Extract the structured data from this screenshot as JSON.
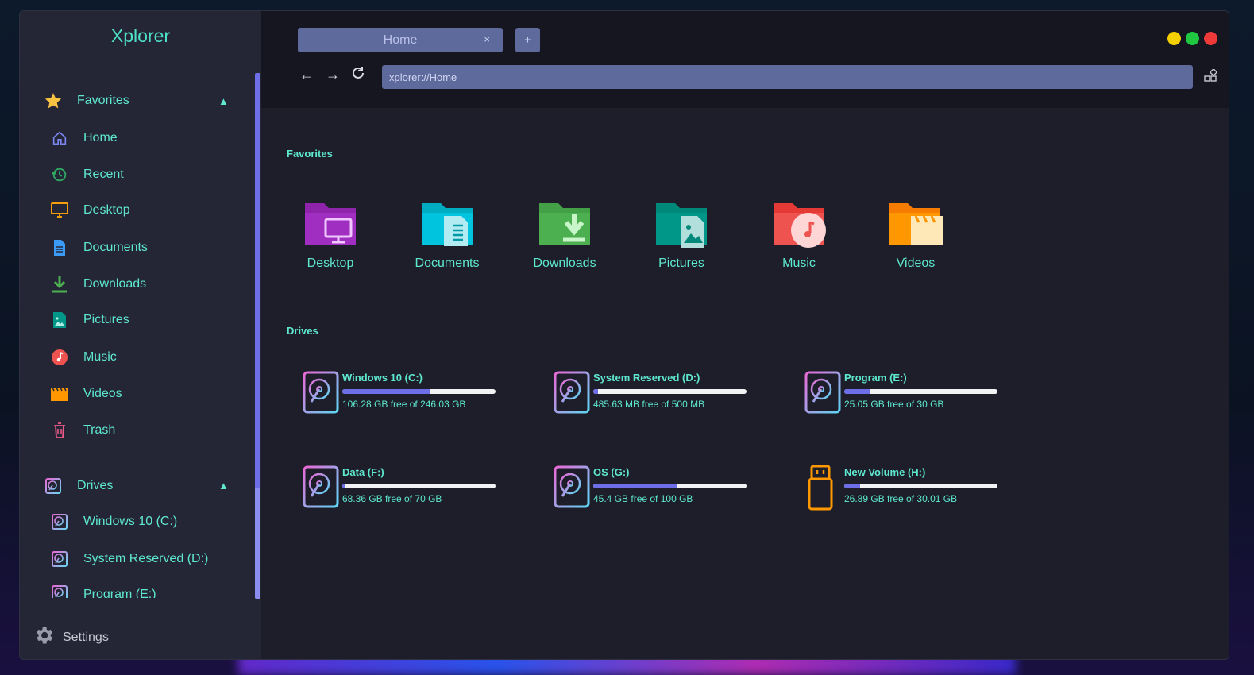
{
  "app": {
    "title": "Xplorer"
  },
  "sidebar": {
    "favorites_label": "Favorites",
    "favorites": [
      {
        "label": "Home",
        "icon": "home-icon"
      },
      {
        "label": "Recent",
        "icon": "recent-icon"
      },
      {
        "label": "Desktop",
        "icon": "desktop-icon"
      },
      {
        "label": "Documents",
        "icon": "document-icon"
      },
      {
        "label": "Downloads",
        "icon": "download-icon"
      },
      {
        "label": "Pictures",
        "icon": "picture-icon"
      },
      {
        "label": "Music",
        "icon": "music-icon"
      },
      {
        "label": "Videos",
        "icon": "video-icon"
      },
      {
        "label": "Trash",
        "icon": "trash-icon"
      }
    ],
    "drives_label": "Drives",
    "drives": [
      {
        "label": "Windows 10 (C:)"
      },
      {
        "label": "System Reserved (D:)"
      },
      {
        "label": "Program (E:)"
      }
    ],
    "settings_label": "Settings"
  },
  "tabs": [
    {
      "label": "Home",
      "close": "×"
    }
  ],
  "new_tab_label": "+",
  "nav": {
    "back": "←",
    "forward": "→",
    "reload": "⟳"
  },
  "address": {
    "value": "xplorer://Home"
  },
  "window_controls": {
    "minimize_color": "#f5d000",
    "maximize_color": "#1fc840",
    "close_color": "#f03a3a"
  },
  "main": {
    "favorites_title": "Favorites",
    "favorites": [
      {
        "label": "Desktop",
        "color": "#8e24aa"
      },
      {
        "label": "Documents",
        "color": "#00bcd4"
      },
      {
        "label": "Downloads",
        "color": "#4caf50"
      },
      {
        "label": "Pictures",
        "color": "#009688"
      },
      {
        "label": "Music",
        "color": "#ef5350"
      },
      {
        "label": "Videos",
        "color": "#ff9800"
      }
    ],
    "drives_title": "Drives",
    "drives": [
      {
        "name": "Windows 10 (C:)",
        "free": "106.28 GB free of 246.03 GB",
        "used_fraction": 0.568,
        "type": "hdd"
      },
      {
        "name": "System Reserved (D:)",
        "free": "485.63 MB free of 500 MB",
        "used_fraction": 0.029,
        "type": "hdd"
      },
      {
        "name": "Program (E:)",
        "free": "25.05 GB free of 30 GB",
        "used_fraction": 0.165,
        "type": "hdd"
      },
      {
        "name": "Data (F:)",
        "free": "68.36 GB free of 70 GB",
        "used_fraction": 0.023,
        "type": "hdd"
      },
      {
        "name": "OS (G:)",
        "free": "45.4 GB free of 100 GB",
        "used_fraction": 0.546,
        "type": "hdd"
      },
      {
        "name": "New Volume (H:)",
        "free": "26.89 GB free of 30.01 GB",
        "used_fraction": 0.104,
        "type": "usb"
      }
    ]
  }
}
